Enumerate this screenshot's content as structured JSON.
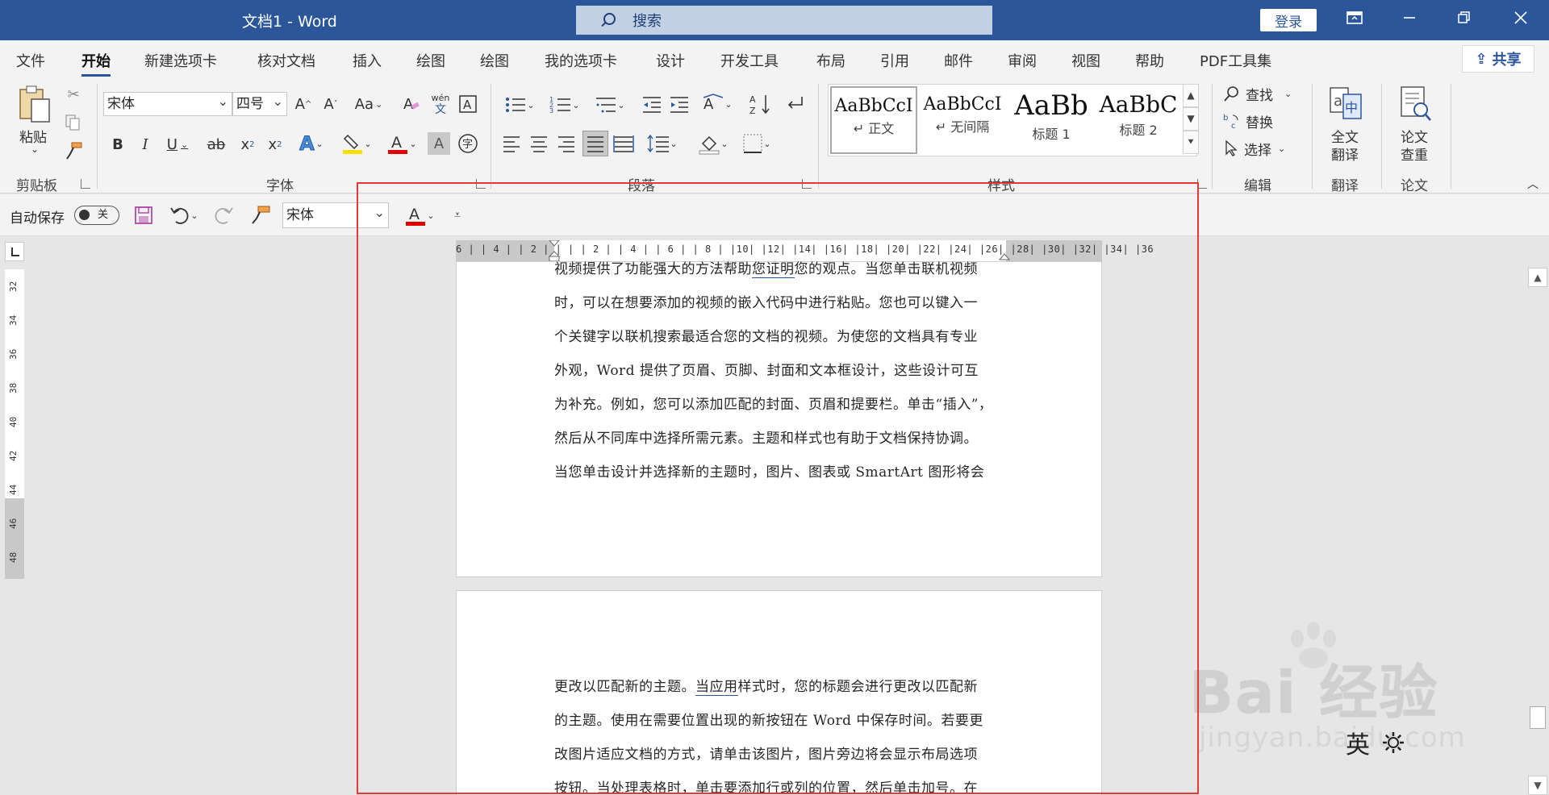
{
  "window": {
    "title": "文档1  -  Word",
    "search_placeholder": "搜索",
    "login": "登录"
  },
  "tabs": [
    "文件",
    "开始",
    "新建选项卡",
    "核对文档",
    "插入",
    "绘图",
    "绘图",
    "我的选项卡",
    "设计",
    "开发工具",
    "布局",
    "引用",
    "邮件",
    "审阅",
    "视图",
    "帮助",
    "PDF工具集"
  ],
  "active_tab": "开始",
  "share_label": "共享",
  "ribbon": {
    "clipboard": {
      "label": "剪贴板",
      "paste": "粘贴"
    },
    "font": {
      "label": "字体",
      "font_name": "宋体",
      "font_size": "四号",
      "grow": "A^",
      "shrink": "Aˇ",
      "case": "Aa",
      "wen": "wén",
      "wen2": "文"
    },
    "paragraph": {
      "label": "段落"
    },
    "styles": {
      "label": "样式",
      "items": [
        {
          "sample": "AaBbCcI",
          "name": "↵ 正文"
        },
        {
          "sample": "AaBbCcI",
          "name": "↵ 无间隔"
        },
        {
          "sample": "AaBb",
          "name": "标题 1"
        },
        {
          "sample": "AaBbC",
          "name": "标题 2"
        }
      ]
    },
    "editing": {
      "label": "编辑",
      "find": "查找",
      "replace": "替换",
      "select": "选择"
    },
    "translate": {
      "label": "翻译",
      "full": "全文",
      "full2": "翻译"
    },
    "paper": {
      "label": "论文",
      "check": "论文",
      "check2": "查重"
    }
  },
  "qat": {
    "autosave": "自动保存",
    "autosave_state": "关",
    "font_name": "宋体"
  },
  "ruler": {
    "horizontal": "6 | | 4 | | 2 | |   | | 2 | | 4 | | 6 | | 8 | |10| |12| |14| |16| |18| |20| |22| |24| |26| |28| |30| |32| |34| |36",
    "vertical": [
      "32",
      "34",
      "36",
      "38",
      "40",
      "42",
      "44",
      "46",
      "48"
    ]
  },
  "document": {
    "page1_lines": [
      "视频提供了功能强大的方法帮助您证明您的观点。当您单击联机视频",
      "时，可以在想要添加的视频的嵌入代码中进行粘贴。您也可以键入一",
      "个关键字以联机搜索最适合您的文档的视频。为使您的文档具有专业",
      "外观，Word 提供了页眉、页脚、封面和文本框设计，这些设计可互",
      "为补充。例如，您可以添加匹配的封面、页眉和提要栏。单击“插入”，",
      "然后从不同库中选择所需元素。主题和样式也有助于文档保持协调。",
      "当您单击设计并选择新的主题时，图片、图表或 SmartArt 图形将会"
    ],
    "page2_lines": [
      "更改以匹配新的主题。当应用样式时，您的标题会进行更改以匹配新",
      "的主题。使用在需要位置出现的新按钮在 Word 中保存时间。若要更",
      "改图片适应文档的方式，请单击该图片，图片旁边将会显示布局选项",
      "按钮。当处理表格时，单击要添加行或列的位置，然后单击加号。在"
    ]
  },
  "watermark": {
    "logo": "Bai 经验",
    "sub": "jingyan.baidu.com"
  },
  "ime": {
    "lang": "英"
  }
}
